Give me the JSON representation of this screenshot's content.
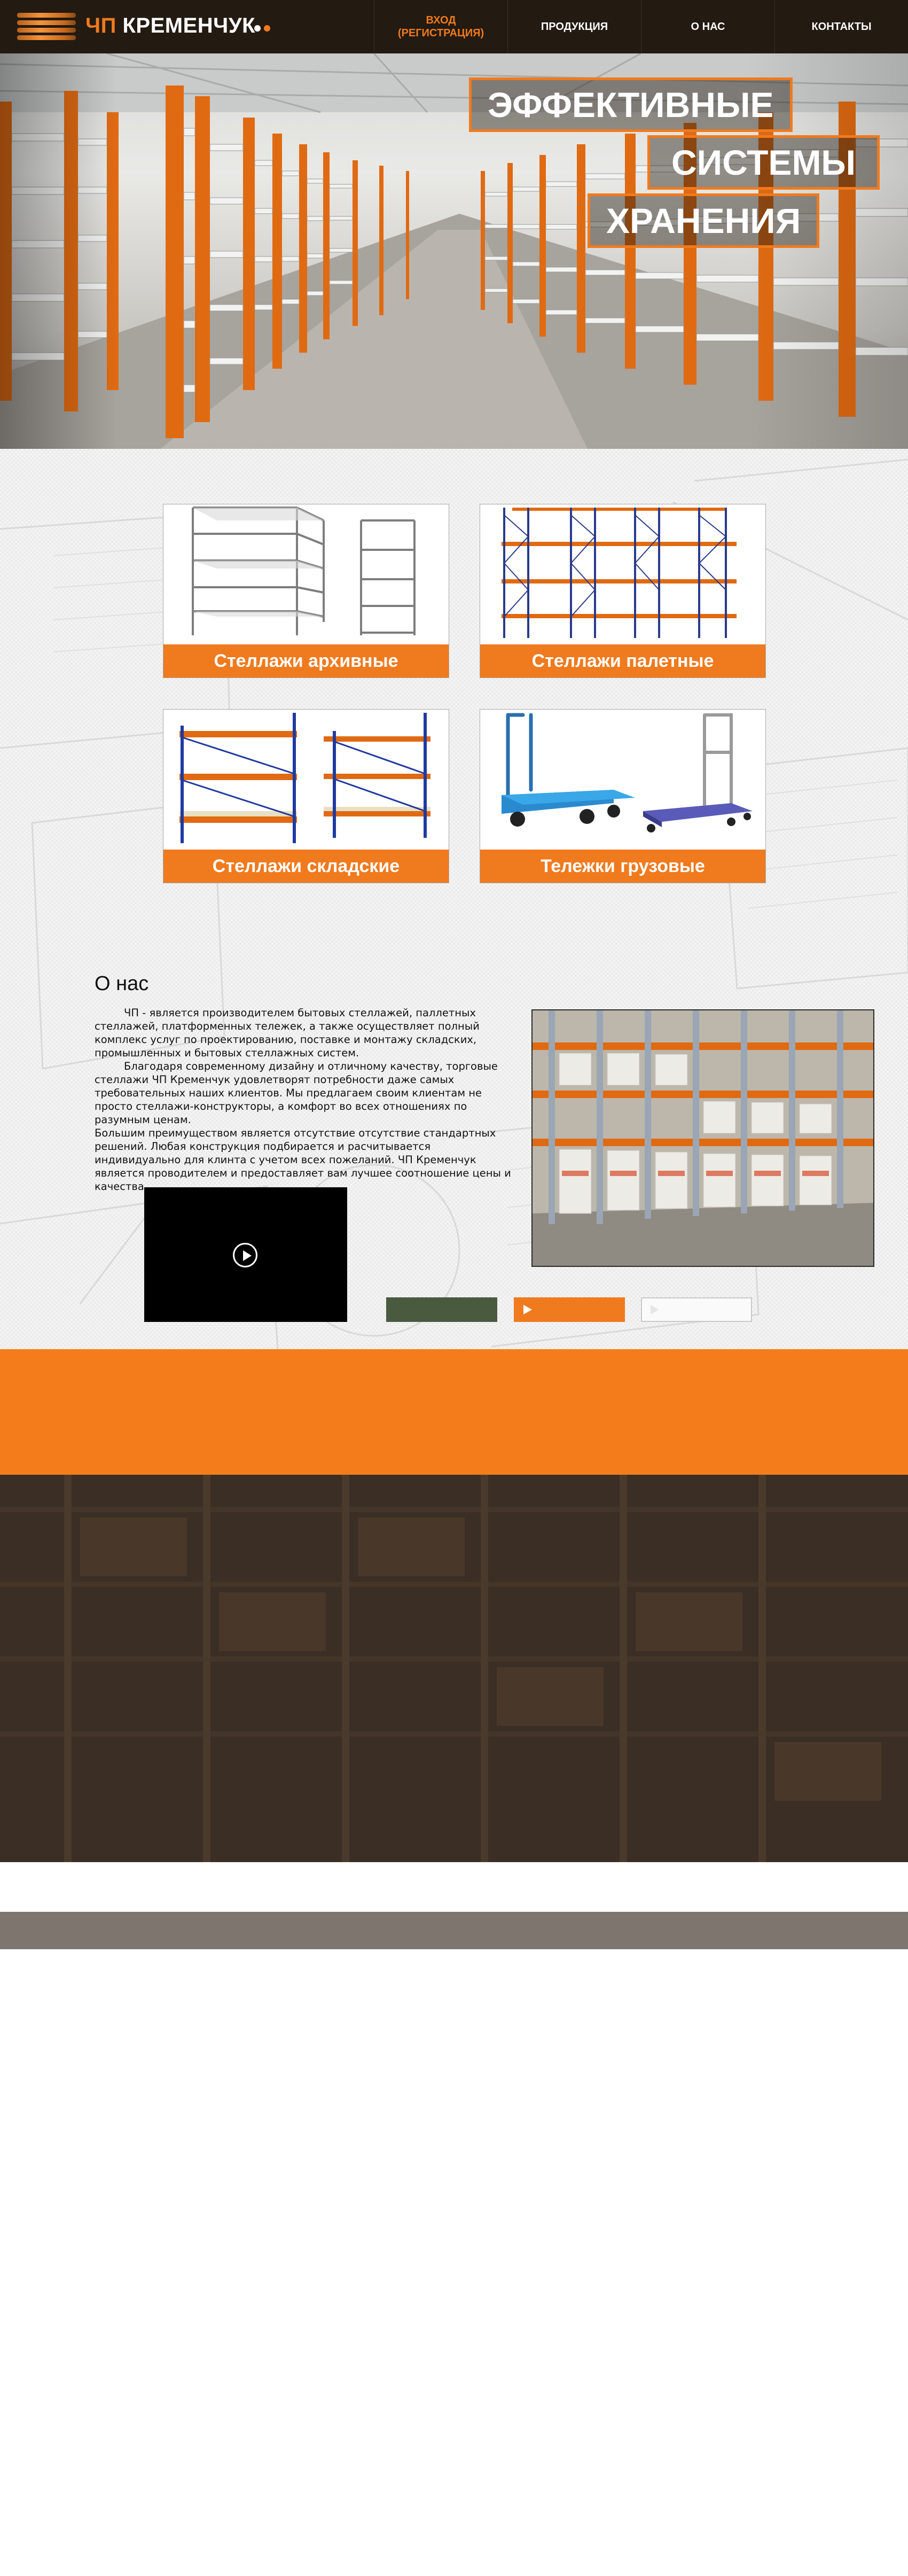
{
  "brand": {
    "prefix": "ЧП",
    "name": "КРЕМЕНЧУК",
    "dot_colors": [
      "#ffffff",
      "#f07a1e"
    ]
  },
  "nav": {
    "items": [
      {
        "label": "ВХОД\n(РЕГИСТРАЦИЯ)",
        "active": true
      },
      {
        "label": "ПРОДУКЦИЯ",
        "active": false
      },
      {
        "label": "О НАС",
        "active": false
      },
      {
        "label": "КОНТАКТЫ",
        "active": false
      }
    ]
  },
  "hero": {
    "lines": [
      "ЭФФЕКТИВНЫЕ",
      "СИСТЕМЫ",
      "ХРАНЕНИЯ"
    ]
  },
  "products": [
    {
      "label": "Стеллажи архивные"
    },
    {
      "label": "Стеллажи палетные"
    },
    {
      "label": "Стеллажи складские"
    },
    {
      "label": "Тележки грузовые"
    }
  ],
  "about": {
    "title": "О нас",
    "paragraphs": [
      "ЧП - является производителем бытовых стеллажей, паллетных стеллажей, платформенных тележек, а также осуществляет полный комплекс услуг по проектированию, поставке и монтажу складских, промышленных и бытовых стеллажных систем.",
      "Благодаря современному дизайну и отличному качеству, торговые стеллажи ЧП Кременчук удовлетворят потребности даже самых требовательных наших клиентов. Мы предлагаем своим клиентам не просто стеллажи-конструкторы, а комфорт во всех отношениях по разумным ценам.",
      "Большим преимуществом является отсутствие отсутствие стандартных решений. Любая конструкция подбирается и расчитывается индивидуально для клинта с учетом всех пожеланий. ЧП Кременчук является проводителем и предоставляет вам лучшее соотношение цены и качества."
    ]
  },
  "colors": {
    "accent": "#f07a1e",
    "header_bg": "#231a12",
    "orange_band": "#f57c1a",
    "dark_band": "#3a2e25",
    "gray_bar": "#7d756e",
    "button_green": "#4a5a3f"
  },
  "icons": [
    "logo-stripes-icon",
    "play-icon",
    "play-triangle-icon"
  ]
}
